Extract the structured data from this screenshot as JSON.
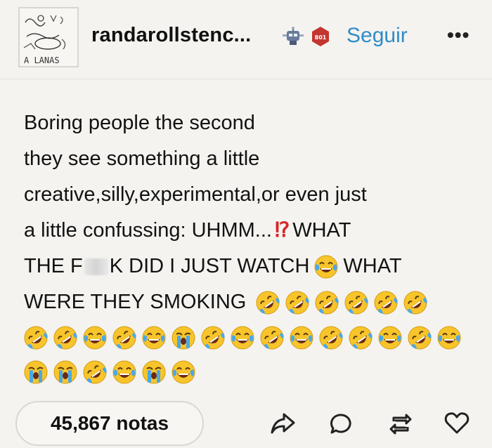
{
  "post": {
    "username": "randarollstenc...",
    "follow_label": "Seguir",
    "more_label": "•••",
    "badge_text": "801",
    "lines": [
      "Boring people the second",
      "they see something a little",
      "creative,silly,experimental,or even just"
    ],
    "line4_text": "a little confussing: UHMM...",
    "line4_punct": "⁉",
    "line4_end": "WHAT",
    "line5_a": "THE F",
    "line5_b": "K DID I JUST WATCH",
    "line5_c": "WHAT",
    "line6": "WERE THEY SMOKING",
    "emoji_rows": [
      [
        "rofl",
        "rofl",
        "rofl",
        "rofl",
        "rofl",
        "rofl"
      ],
      [
        "rofl",
        "rofl",
        "joy",
        "rofl",
        "joy",
        "sob",
        "rofl",
        "joy",
        "rofl",
        "joy",
        "rofl",
        "rofl",
        "joy",
        "rofl",
        "joy"
      ],
      [
        "sob",
        "sob",
        "rofl",
        "joy",
        "sob",
        "joy"
      ]
    ]
  },
  "footer": {
    "notes_label": "45,867 notas",
    "actions": [
      "share-icon",
      "reply-icon",
      "reblog-icon",
      "like-icon"
    ]
  },
  "colors": {
    "background": "#f4f3ef",
    "accent": "#2f8cc9",
    "text": "#121212",
    "emoji_yellow": "#f7c52b",
    "tear_blue": "#4aa8e8"
  }
}
